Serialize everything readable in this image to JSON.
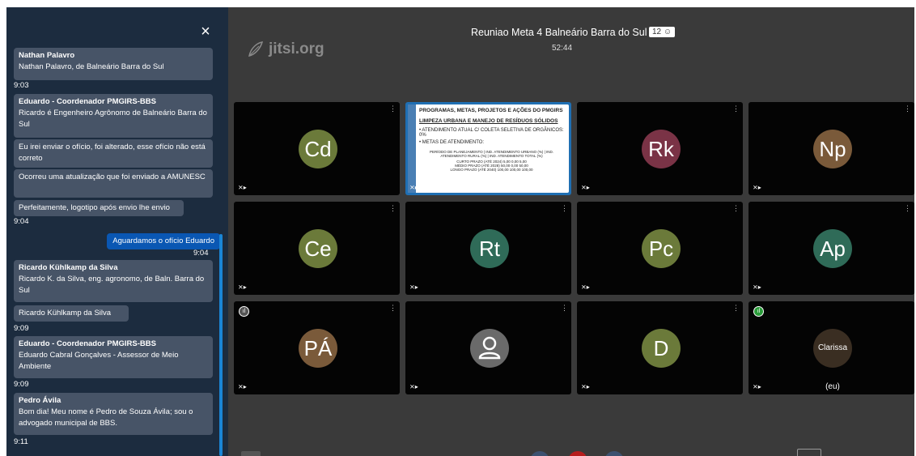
{
  "chat": {
    "close_label": "×",
    "messages": [
      {
        "sender": "Nathan Palavro",
        "text": "Nathan Palavro, de Balneário Barra do Sul",
        "time": "9:03"
      },
      {
        "sender": "Eduardo - Coordenador PMGIRS-BBS",
        "text": "Ricardo é Engenheiro Agrônomo de Balneário Barra do Sul",
        "time": ""
      },
      {
        "sender": "",
        "text": "Eu irei enviar o ofício, foi alterado, esse ofício não está correto",
        "time": ""
      },
      {
        "sender": "",
        "text": "Ocorreu uma atualização que foi enviado a AMUNESC",
        "time": ""
      },
      {
        "sender": "",
        "text": "Perfeitamente, logotipo após envio lhe envio",
        "time": "9:04"
      },
      {
        "sender": "Ricardo Kühlkamp da Silva",
        "text": "Ricardo K. da Silva, eng. agronomo, de Baln. Barra do Sul",
        "time": ""
      },
      {
        "sender": "",
        "text": "Ricardo Kühlkamp da Silva",
        "time": "9:09"
      },
      {
        "sender": "Eduardo - Coordenador PMGIRS-BBS",
        "text": "Eduardo Cabral Gonçalves - Assessor de Meio Ambiente",
        "time": "9:09"
      },
      {
        "sender": "Pedro Ávila",
        "text": "Bom dia! Meu nome é Pedro de Souza Ávila; sou o advogado municipal de BBS.",
        "time": "9:11"
      }
    ],
    "own_message": {
      "text": "Aguardamos o ofício Eduardo",
      "time": "9:04"
    }
  },
  "header": {
    "logo": "jitsi.org",
    "title": "Reuniao Meta 4 Balneário Barra do Sul",
    "participant_count": "12",
    "timer": "52:44"
  },
  "slide": {
    "title": "PROGRAMAS, METAS, PROJETOS E AÇÕES DO PMGIRS",
    "subtitle": "LIMPEZA URBANA E MANEJO DE RESÍDUOS SÓLIDOS",
    "line1": "• ATENDIMENTO ATUAL C/ COLETA SELETIVA DE ORGÂNICOS: 0%",
    "line2": "• METAS DE ATENDIMENTO:",
    "table_header": "PERÍODO DE PLANEJAMENTO  |  IND. ATENDIMENTO URBANO (%)  |  IND. ATENDIMENTO RURAL (%)  |  IND. ATENDIMENTO TOTAL (%)",
    "rows": [
      "CURTO PRAZO (ATÉ 2024)  5,00  0,00  5,00",
      "MÉDIO PRAZO (ATÉ 2028)  50,00  0,00  50,00",
      "LONGO PRAZO (ATÉ 2040)  100,00  100,00  100,00"
    ]
  },
  "tiles": [
    {
      "initials": "Cd",
      "color": "#6b7a3a"
    },
    {
      "initials": "",
      "color": ""
    },
    {
      "initials": "Rk",
      "color": "#7a3346"
    },
    {
      "initials": "Np",
      "color": "#7a5a3a"
    },
    {
      "initials": "Ce",
      "color": "#6b7a3a"
    },
    {
      "initials": "Rt",
      "color": "#2f6b58"
    },
    {
      "initials": "Pc",
      "color": "#6b7a3a"
    },
    {
      "initials": "Ap",
      "color": "#2f6b58"
    },
    {
      "initials": "PÁ",
      "color": "#7a5a3a"
    },
    {
      "initials": "",
      "color": "#6a6a6a"
    },
    {
      "initials": "D",
      "color": "#6b7a3a"
    },
    {
      "initials": "",
      "color": "#3a2e22"
    }
  ],
  "self_label": "Clarissa (eu)"
}
